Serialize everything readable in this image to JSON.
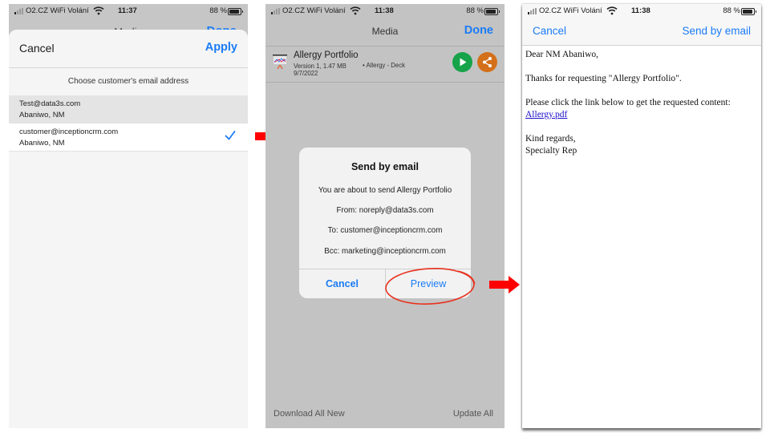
{
  "status_bars": [
    {
      "carrier": "O2.CZ WiFi Volání",
      "time": "11:37",
      "battery": "88 %"
    },
    {
      "carrier": "O2.CZ WiFi Volání",
      "time": "11:38",
      "battery": "88 %"
    },
    {
      "carrier": "O2.CZ WiFi Volání",
      "time": "11:38",
      "battery": "88 %"
    }
  ],
  "panel1": {
    "behind_title": "Media",
    "behind_done": "Done",
    "cancel_label": "Cancel",
    "apply_label": "Apply",
    "section_title": "Choose customer's email address",
    "addresses": [
      {
        "email": "Test@data3s.com",
        "name": "Abaniwo, NM",
        "checked": false
      },
      {
        "email": "customer@inceptioncrm.com",
        "name": "Abaniwo, NM",
        "checked": true
      }
    ]
  },
  "panel2": {
    "nav_title": "Media",
    "done_label": "Done",
    "item": {
      "title": "Allergy Portfolio",
      "meta": "Version 1, 1.47 MB",
      "date": "9/7/2022",
      "tags": "• Allergy - Deck",
      "play_icon": "play-icon",
      "share_icon": "share-icon"
    },
    "dialog": {
      "title": "Send by email",
      "message": "You are about to send Allergy Portfolio",
      "from": "From: noreply@data3s.com",
      "to": "To: customer@inceptioncrm.com",
      "bcc": "Bcc: marketing@inceptioncrm.com",
      "cancel_label": "Cancel",
      "preview_label": "Preview"
    },
    "download_all_label": "Download All New",
    "update_all_label": "Update All"
  },
  "panel3": {
    "cancel_label": "Cancel",
    "send_label": "Send by email",
    "greeting": "Dear NM Abaniwo,",
    "thanks": "Thanks for requesting \"Allergy Portfolio\".",
    "instruction": "Please click the link below to get the requested content:",
    "link_text": "Allergy.pdf",
    "closing": "Kind regards,",
    "signature": "Specialty Rep"
  },
  "annotations": {
    "arrow_color": "#ff0000",
    "circle_color": "#e8321e"
  }
}
